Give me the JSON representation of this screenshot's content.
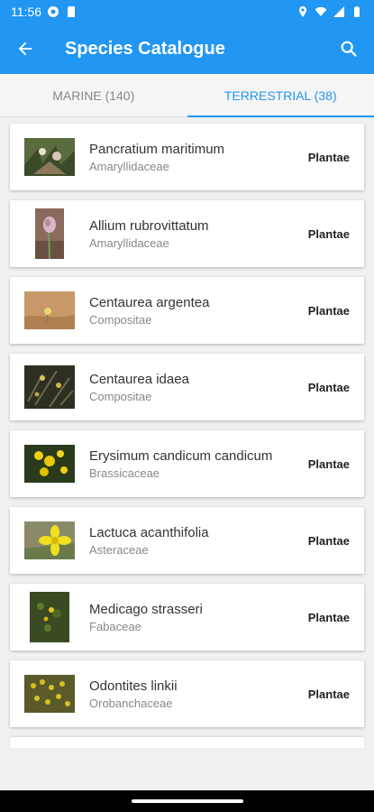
{
  "status": {
    "time": "11:56"
  },
  "app_bar": {
    "title": "Species Catalogue"
  },
  "tabs": [
    {
      "label": "MARINE (140)",
      "active": false
    },
    {
      "label": "TERRESTRIAL (38)",
      "active": true
    }
  ],
  "colors": {
    "primary": "#2196F3",
    "background": "#f0f0f0"
  },
  "species": [
    {
      "name": "Pancratium maritimum",
      "family": "Amaryllidaceae",
      "kingdom": "Plantae"
    },
    {
      "name": "Allium rubrovittatum",
      "family": "Amaryllidaceae",
      "kingdom": "Plantae"
    },
    {
      "name": "Centaurea argentea",
      "family": "Compositae",
      "kingdom": "Plantae"
    },
    {
      "name": "Centaurea idaea",
      "family": "Compositae",
      "kingdom": "Plantae"
    },
    {
      "name": "Erysimum candicum candicum",
      "family": "Brassicaceae",
      "kingdom": "Plantae"
    },
    {
      "name": "Lactuca acanthifolia",
      "family": "Asteraceae",
      "kingdom": "Plantae"
    },
    {
      "name": "Medicago strasseri",
      "family": "Fabaceae",
      "kingdom": "Plantae"
    },
    {
      "name": "Odontites linkii",
      "family": "Orobanchaceae",
      "kingdom": "Plantae"
    }
  ]
}
